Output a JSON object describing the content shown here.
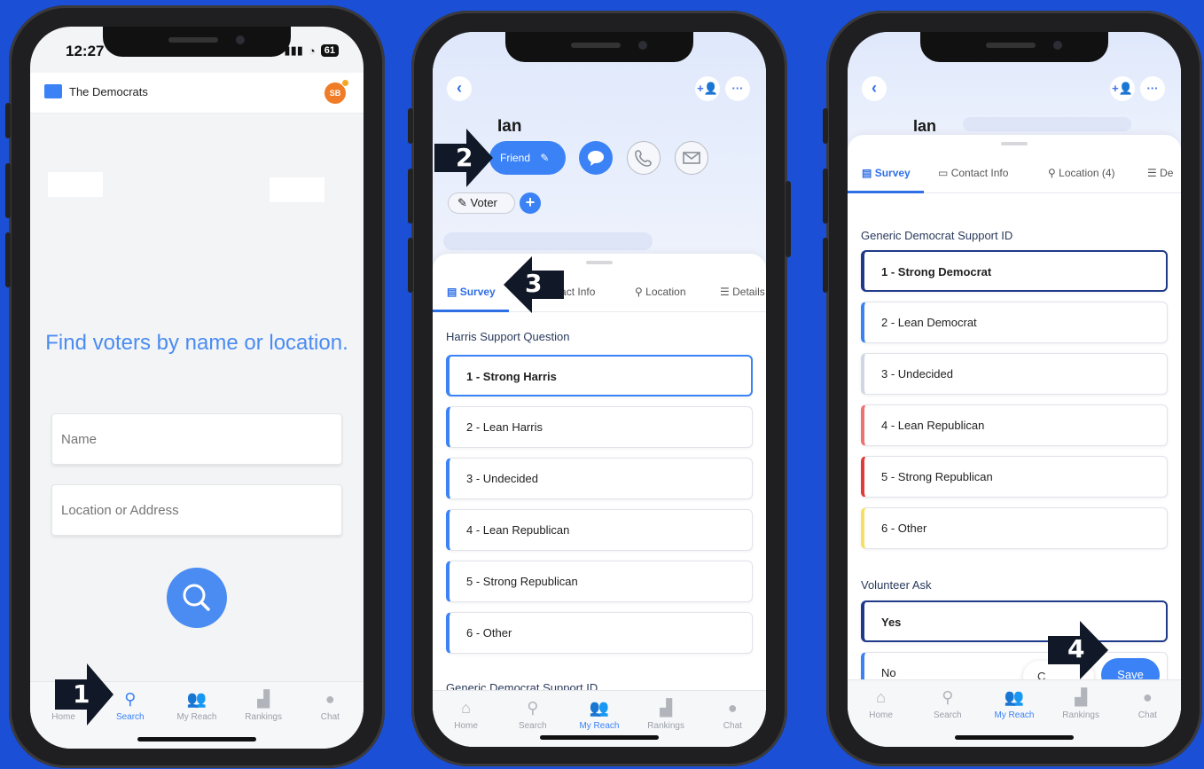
{
  "phone1": {
    "status": {
      "time": "12:27",
      "battery": "61"
    },
    "app_name": "The Democrats",
    "avatar_initials": "SB",
    "headline": "Find voters by name or location.",
    "name_placeholder": "Name",
    "location_placeholder": "Location or Address",
    "tabs": [
      "Home",
      "Search",
      "My Reach",
      "Rankings",
      "Chat"
    ],
    "active_tab": "Search"
  },
  "phone2": {
    "contact_name": "Ian",
    "relationship_label": "Friend",
    "tag": "Voter",
    "sheet_tabs": [
      "Survey",
      "Contact Info",
      "Location",
      "Details"
    ],
    "question1": {
      "title": "Harris Support Question",
      "options": [
        "1 - Strong Harris",
        "2 - Lean Harris",
        "3 - Undecided",
        "4 - Lean Republican",
        "5 - Strong Republican",
        "6 - Other"
      ],
      "selected": 0
    },
    "question2_title": "Generic Democrat Support ID",
    "tabs": [
      "Home",
      "Search",
      "My Reach",
      "Rankings",
      "Chat"
    ],
    "active_tab": "My Reach"
  },
  "phone3": {
    "contact_name": "Ian",
    "sheet_tabs": [
      "Survey",
      "Contact Info",
      "Location (4)",
      "De"
    ],
    "question2": {
      "title": "Generic Democrat Support ID",
      "options": [
        "1 - Strong Democrat",
        "2 - Lean Democrat",
        "3 - Undecided",
        "4 - Lean Republican",
        "5 - Strong Republican",
        "6 - Other"
      ],
      "accents": [
        "#1f3a8a",
        "#3b82f6",
        "#cfd6e4",
        "#f07171",
        "#e23b3b",
        "#f5e063"
      ],
      "selected": 0
    },
    "question3": {
      "title": "Volunteer Ask",
      "options": [
        "Yes",
        "No"
      ],
      "selected": 0
    },
    "cancel_label": "C",
    "save_label": "Save",
    "tabs": [
      "Home",
      "Search",
      "My Reach",
      "Rankings",
      "Chat"
    ],
    "active_tab": "My Reach"
  },
  "steps": [
    "1",
    "2",
    "3",
    "4"
  ]
}
